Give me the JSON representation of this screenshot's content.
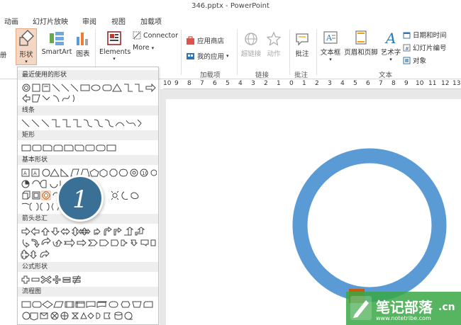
{
  "titlebar": {
    "title": "346.pptx - PowerPoint"
  },
  "tabs": [
    "动画",
    "幻灯片放映",
    "审阅",
    "视图",
    "加载项"
  ],
  "ribbon": {
    "left_partial": "册",
    "shapes_label": "形状",
    "smartart_label": "SmartArt",
    "chart_label": "图表",
    "elements_label": "Elements",
    "connector_label": "Connector",
    "more_label": "More",
    "app_store_label": "应用商店",
    "my_apps_label": "我的应用",
    "addins_group": "加载项",
    "hyperlink_label": "超链接",
    "action_label": "动作",
    "links_group": "链接",
    "comment_label": "批注",
    "comments_group": "批注",
    "textbox_label": "文本框",
    "header_footer_label": "页眉和页脚",
    "wordart_label": "艺术字",
    "datetime_label": "日期和时间",
    "slide_number_label": "幻灯片编号",
    "object_label": "对象",
    "text_group": "文本"
  },
  "panel": {
    "sections": [
      "最近使用的形状",
      "线条",
      "矩形",
      "基本形状",
      "箭头总汇",
      "公式形状",
      "流程图"
    ]
  },
  "ruler": {
    "ticks": [
      "10",
      "9",
      "8",
      "7",
      "6",
      "5",
      "4",
      "3",
      "2",
      "1",
      "0",
      "1",
      "2",
      "3",
      "4",
      "5",
      "6",
      "7",
      "8",
      "9",
      "10",
      "11",
      "12",
      "13"
    ]
  },
  "callout": {
    "number": "1"
  },
  "watermark": {
    "text": "笔记部落",
    "domain": "www.notetribe.com",
    "suffix": ".cn"
  },
  "colors": {
    "ring": "#5b9bd5",
    "callout": "#3a6f96",
    "accent": "#c55a11"
  }
}
